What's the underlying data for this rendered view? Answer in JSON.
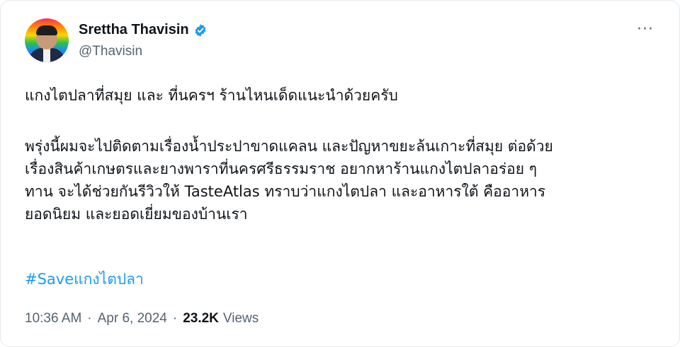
{
  "author": {
    "display_name": "Srettha Thavisin",
    "handle": "@Thavisin",
    "verified_icon": "verified-badge-icon",
    "verified_color": "#1d9bf0"
  },
  "tweet": {
    "line_1": "แกงไตปลาที่สมุย และ ที่นครฯ ร้านไหนเด็ดแนะนำด้วยครับ",
    "paragraph_2_lines": [
      "พรุ่งนี้ผมจะไปติดตามเรื่องน้ำประปาขาดแคลน และปัญหาขยะล้นเกาะที่สมุย ต่อด้วย",
      "เรื่องสินค้าเกษตรและยางพาราที่นครศรีธรรมราช อยากหาร้านแกงไตปลาอร่อย ๆ",
      "ทาน จะได้ช่วยกันรีวิวให้ TasteAtlas ทราบว่าแกงไตปลา และอาหารใต้ คืออาหาร",
      "ยอดนิยม และยอดเยี่ยมของบ้านเรา"
    ],
    "hashtag": "#Saveแกงไตปลา",
    "hashtag_color": "#1d9bf0"
  },
  "meta": {
    "time": "10:36 AM",
    "separator": "·",
    "date": "Apr 6, 2024",
    "views_count": "23.2K",
    "views_label": "Views"
  },
  "more_menu_label": "···",
  "colors": {
    "text": "#0f1419",
    "secondary": "#536471",
    "border": "#e6e9ec"
  }
}
